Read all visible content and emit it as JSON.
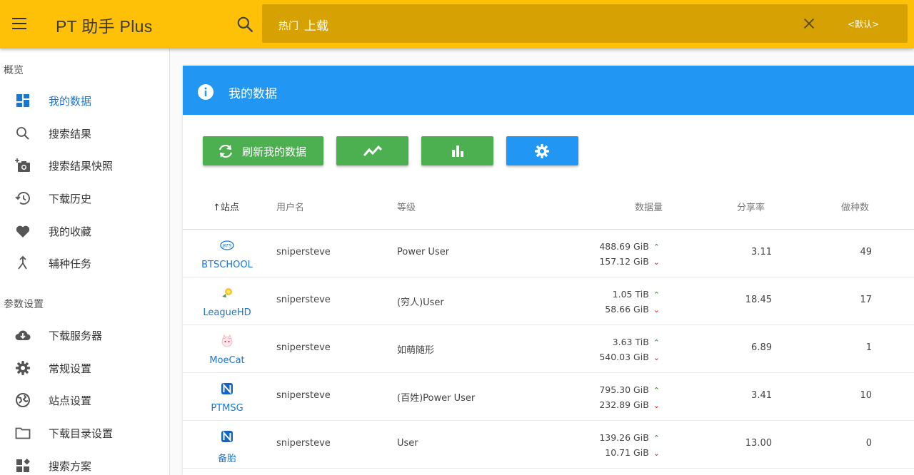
{
  "app": {
    "title": "PT 助手 Plus"
  },
  "search": {
    "tag": "热门",
    "value": "上载",
    "scheme": "<默认>"
  },
  "sidebar": {
    "section1": "概览",
    "section2": "参数设置",
    "items": [
      {
        "label": "我的数据",
        "icon": "dashboard-icon"
      },
      {
        "label": "搜索结果",
        "icon": "search-icon"
      },
      {
        "label": "搜索结果快照",
        "icon": "camera-add-icon"
      },
      {
        "label": "下载历史",
        "icon": "history-icon"
      },
      {
        "label": "我的收藏",
        "icon": "heart-icon"
      },
      {
        "label": "辅种任务",
        "icon": "merge-icon"
      },
      {
        "label": "下载服务器",
        "icon": "cloud-download-icon"
      },
      {
        "label": "常规设置",
        "icon": "gear-icon"
      },
      {
        "label": "站点设置",
        "icon": "globe-icon"
      },
      {
        "label": "下载目录设置",
        "icon": "folder-icon"
      },
      {
        "label": "搜索方案",
        "icon": "widgets-icon"
      }
    ]
  },
  "card": {
    "title": "我的数据",
    "refresh_label": "刷新我的数据",
    "header_color": "#2196f3",
    "button_color": "#4caf50"
  },
  "table": {
    "headers": {
      "site": "↑站点",
      "username": "用户名",
      "level": "等级",
      "data": "数据量",
      "ratio": "分享率",
      "seeds": "做种数"
    },
    "rows": [
      {
        "site": "BTSCHOOL",
        "username": "snipersteve",
        "level": "Power User",
        "upload": "488.69 GiB",
        "download": "157.12 GiB",
        "ratio": "3.11",
        "seeds": "49"
      },
      {
        "site": "LeagueHD",
        "username": "snipersteve",
        "level": "(穷人)User",
        "upload": "1.05 TiB",
        "download": "58.66 GiB",
        "ratio": "18.45",
        "seeds": "17"
      },
      {
        "site": "MoeCat",
        "username": "snipersteve",
        "level": "如萌随形",
        "upload": "3.63 TiB",
        "download": "540.03 GiB",
        "ratio": "6.89",
        "seeds": "1"
      },
      {
        "site": "PTMSG",
        "username": "snipersteve",
        "level": "(百姓)Power User",
        "upload": "795.30 GiB",
        "download": "232.89 GiB",
        "ratio": "3.41",
        "seeds": "10"
      },
      {
        "site": "备胎",
        "username": "snipersteve",
        "level": "User",
        "upload": "139.26 GiB",
        "download": "10.71 GiB",
        "ratio": "13.00",
        "seeds": "0"
      }
    ]
  }
}
